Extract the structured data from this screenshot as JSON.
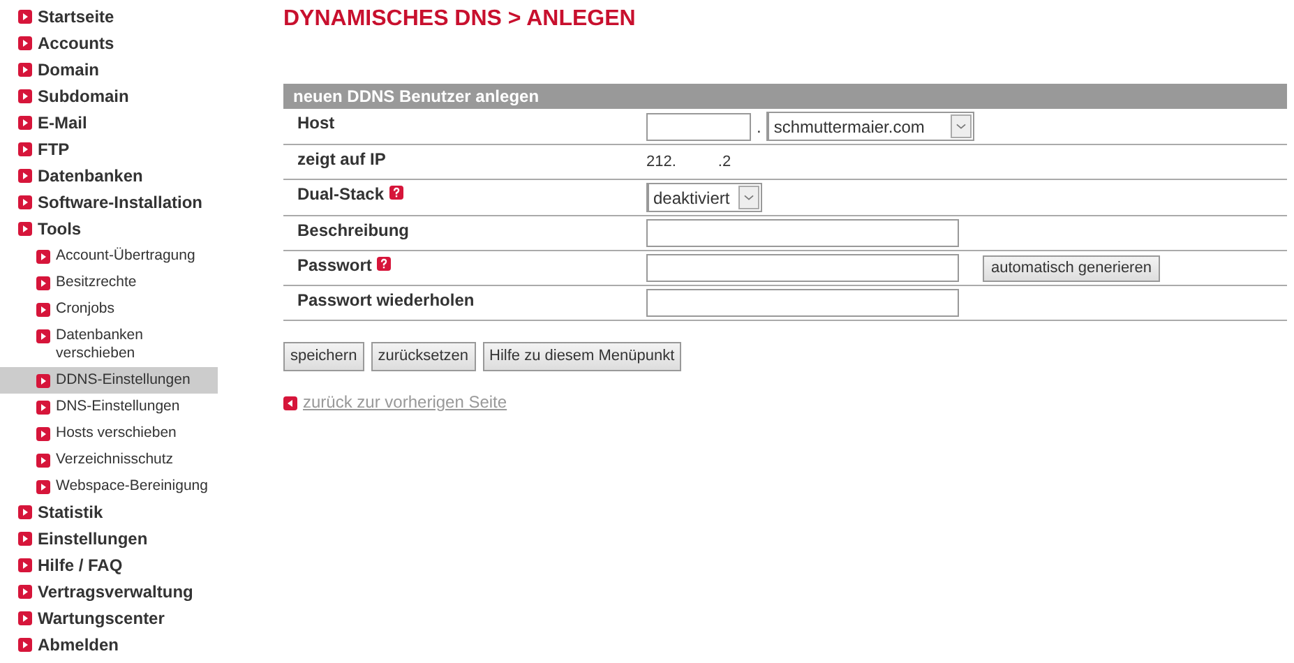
{
  "sidebar": {
    "items": [
      {
        "label": "Startseite",
        "selected": false
      },
      {
        "label": "Accounts",
        "selected": false
      },
      {
        "label": "Domain",
        "selected": false
      },
      {
        "label": "Subdomain",
        "selected": false
      },
      {
        "label": "E-Mail",
        "selected": false
      },
      {
        "label": "FTP",
        "selected": false
      },
      {
        "label": "Datenbanken",
        "selected": false
      },
      {
        "label": "Software-Installation",
        "selected": false
      },
      {
        "label": "Tools",
        "selected": false,
        "children": [
          {
            "label": "Account-Übertragung",
            "selected": false
          },
          {
            "label": "Besitzrechte",
            "selected": false
          },
          {
            "label": "Cronjobs",
            "selected": false
          },
          {
            "label": "Datenbanken verschieben",
            "selected": false
          },
          {
            "label": "DDNS-Einstellungen",
            "selected": true
          },
          {
            "label": "DNS-Einstellungen",
            "selected": false
          },
          {
            "label": "Hosts verschieben",
            "selected": false
          },
          {
            "label": "Verzeichnisschutz",
            "selected": false
          },
          {
            "label": "Webspace-Bereinigung",
            "selected": false
          }
        ]
      },
      {
        "label": "Statistik",
        "selected": false
      },
      {
        "label": "Einstellungen",
        "selected": false
      },
      {
        "label": "Hilfe / FAQ",
        "selected": false
      },
      {
        "label": "Vertragsverwaltung",
        "selected": false
      },
      {
        "label": "Wartungscenter",
        "selected": false
      },
      {
        "label": "Abmelden",
        "selected": false
      }
    ]
  },
  "page_title": "DYNAMISCHES DNS > ANLEGEN",
  "form": {
    "title": "neuen DDNS Benutzer anlegen",
    "rows": [
      {
        "label": "Host",
        "help": false,
        "kind": "host",
        "separator": ".",
        "select_value": "schmuttermaier.com"
      },
      {
        "label": "zeigt auf IP",
        "help": false,
        "kind": "ip",
        "parts": [
          "212.",
          ".2"
        ]
      },
      {
        "label": "Dual-Stack",
        "help": true,
        "kind": "select",
        "select_value": "deaktiviert"
      },
      {
        "label": "Beschreibung",
        "help": false,
        "kind": "text"
      },
      {
        "label": "Passwort",
        "help": true,
        "kind": "password",
        "button": "automatisch generieren"
      },
      {
        "label": "Passwort wiederholen",
        "help": false,
        "kind": "password"
      }
    ]
  },
  "buttons": [
    "speichern",
    "zurücksetzen",
    "Hilfe zu diesem Menüpunkt"
  ],
  "back_link": "zurück zur vorherigen Seite"
}
